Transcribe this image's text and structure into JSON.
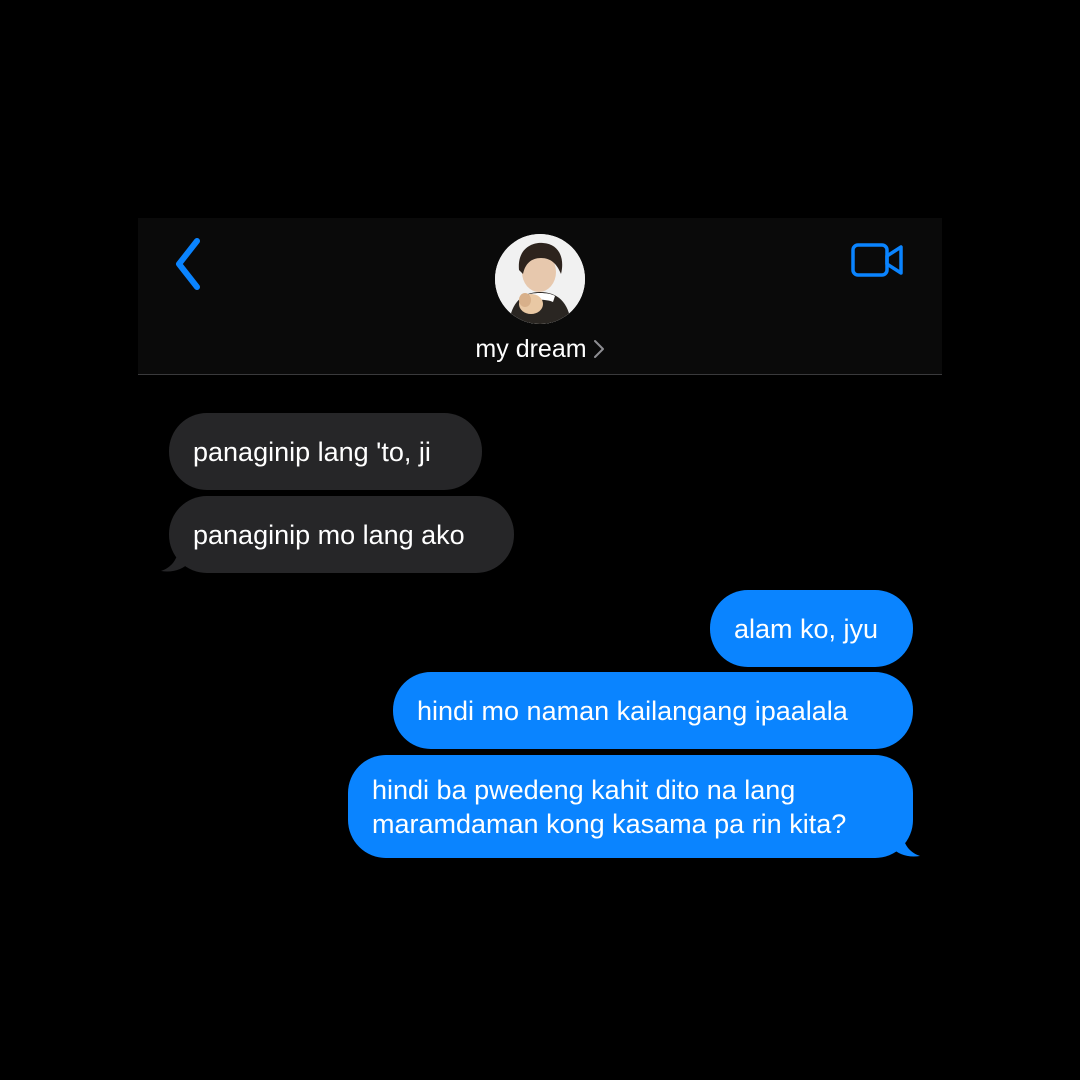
{
  "header": {
    "contact_name": "my dream",
    "back_icon": "chevron-left-icon",
    "video_icon": "video-camera-icon",
    "chevron_icon": "chevron-right-icon"
  },
  "messages": [
    {
      "direction": "received",
      "lines": [
        "panaginip lang 'to, ji"
      ]
    },
    {
      "direction": "received",
      "lines": [
        "panaginip mo lang ako"
      ]
    },
    {
      "direction": "sent",
      "lines": [
        "alam ko, jyu"
      ]
    },
    {
      "direction": "sent",
      "lines": [
        "hindi mo naman kailangang ipaalala"
      ]
    },
    {
      "direction": "sent",
      "lines": [
        "hindi ba pwedeng kahit dito na lang",
        "maramdaman kong kasama pa rin kita?"
      ]
    }
  ],
  "colors": {
    "background": "#000000",
    "accent": "#0a84ff",
    "received_bubble": "#262628",
    "sent_bubble": "#0a84ff",
    "text": "#ffffff"
  }
}
